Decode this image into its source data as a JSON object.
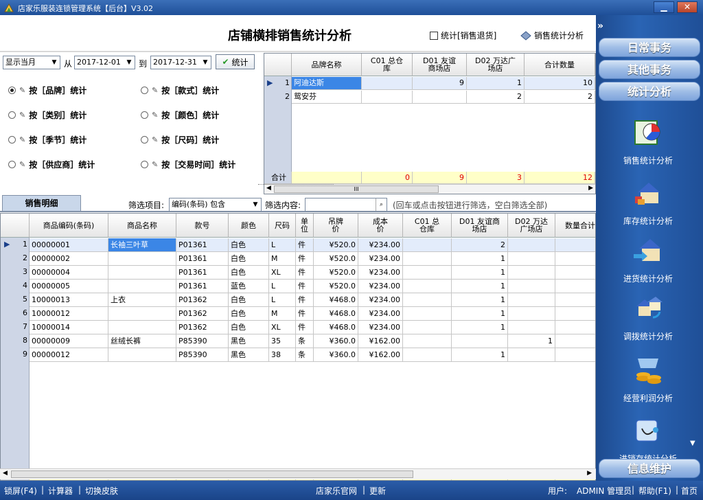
{
  "window": {
    "title": "店家乐服装连锁管理系统【后台】V3.02",
    "minimize": "▁",
    "close": "✕"
  },
  "header": {
    "title": "店铺横排销售统计分析",
    "return_check_label": "统计[销售退货]",
    "analysis_label": "销售统计分析"
  },
  "filter": {
    "period": "显示当月",
    "from_label": "从",
    "from_date": "2017-12-01",
    "to_label": "到",
    "to_date": "2017-12-31",
    "stat_button": "统计"
  },
  "group_by": [
    {
      "label": "按［品牌］统计",
      "checked": true
    },
    {
      "label": "按［款式］统计",
      "checked": false
    },
    {
      "label": "按［类别］统计",
      "checked": false
    },
    {
      "label": "按［颜色］统计",
      "checked": false
    },
    {
      "label": "按［季节］统计",
      "checked": false
    },
    {
      "label": "按［尺码］统计",
      "checked": false
    },
    {
      "label": "按［供应商］统计",
      "checked": false
    },
    {
      "label": "按［交易时间］统计",
      "checked": false
    }
  ],
  "brand_grid": {
    "columns": [
      "品牌名称",
      "C01 总仓库",
      "D01 友谊商场店",
      "D02 万达广场店",
      "合计数量"
    ],
    "rows": [
      {
        "no": "1",
        "cells": [
          "阿迪达斯",
          "",
          "9",
          "1",
          "10"
        ]
      },
      {
        "no": "2",
        "cells": [
          "鸳安芬",
          "",
          "",
          "2",
          "2"
        ]
      }
    ],
    "sum_label": "合计",
    "sum": [
      "",
      "0",
      "9",
      "3",
      "12"
    ],
    "scroll_mark": "III"
  },
  "detail": {
    "tab_label": "销售明细",
    "filter_item_label": "筛选项目:",
    "filter_item_value": "编码(条码) 包含",
    "filter_content_label": "筛选内容:",
    "filter_content_value": "",
    "hint": "(回车或点击按钮进行筛选，空白筛选全部)",
    "columns": [
      "商品编码(条码)",
      "商品名称",
      "款号",
      "颜色",
      "尺码",
      "单位",
      "吊牌价",
      "成本价",
      "C01 总仓库",
      "D01 友谊商场店",
      "D02 万达广场店",
      "数量合计"
    ],
    "rows": [
      {
        "no": "1",
        "cells": [
          "00000001",
          "长袖三叶草",
          "P01361",
          "白色",
          "L",
          "件",
          "¥520.0",
          "¥234.00",
          "",
          "2",
          "",
          ""
        ]
      },
      {
        "no": "2",
        "cells": [
          "00000002",
          "",
          "P01361",
          "白色",
          "M",
          "件",
          "¥520.0",
          "¥234.00",
          "",
          "1",
          "",
          ""
        ]
      },
      {
        "no": "3",
        "cells": [
          "00000004",
          "",
          "P01361",
          "白色",
          "XL",
          "件",
          "¥520.0",
          "¥234.00",
          "",
          "1",
          "",
          ""
        ]
      },
      {
        "no": "4",
        "cells": [
          "00000005",
          "",
          "P01361",
          "蓝色",
          "L",
          "件",
          "¥520.0",
          "¥234.00",
          "",
          "1",
          "",
          ""
        ]
      },
      {
        "no": "5",
        "cells": [
          "10000013",
          "上衣",
          "P01362",
          "白色",
          "L",
          "件",
          "¥468.0",
          "¥234.00",
          "",
          "1",
          "",
          ""
        ]
      },
      {
        "no": "6",
        "cells": [
          "10000012",
          "",
          "P01362",
          "白色",
          "M",
          "件",
          "¥468.0",
          "¥234.00",
          "",
          "1",
          "",
          ""
        ]
      },
      {
        "no": "7",
        "cells": [
          "10000014",
          "",
          "P01362",
          "白色",
          "XL",
          "件",
          "¥468.0",
          "¥234.00",
          "",
          "1",
          "",
          ""
        ]
      },
      {
        "no": "8",
        "cells": [
          "00000009",
          "丝绒长裤",
          "P85390",
          "黑色",
          "35",
          "条",
          "¥360.0",
          "¥162.00",
          "",
          "",
          "1",
          ""
        ]
      },
      {
        "no": "9",
        "cells": [
          "00000012",
          "",
          "P85390",
          "黑色",
          "38",
          "条",
          "¥360.0",
          "¥162.00",
          "",
          "1",
          "",
          ""
        ]
      }
    ],
    "sum_label": "合计",
    "sum": [
      "",
      "",
      "",
      "",
      "",
      "",
      "",
      "",
      "0",
      "9",
      "1",
      ""
    ]
  },
  "sidebar": {
    "expand": "»",
    "nav": [
      "日常事务",
      "其他事务",
      "统计分析"
    ],
    "items": [
      "销售统计分析",
      "库存统计分析",
      "进货统计分析",
      "调拨统计分析",
      "经营利润分析",
      "进销存统计分析"
    ],
    "bottom": "信息维护"
  },
  "status": {
    "lock": "锁屏(F4)",
    "sep": "|",
    "calculator": "计算器",
    "skin": "切换皮肤",
    "website": "店家乐官网",
    "update": "更新",
    "user_label": "用户:",
    "user_name": "ADMIN 管理员",
    "help": "帮助(F1)",
    "home": "首页"
  }
}
